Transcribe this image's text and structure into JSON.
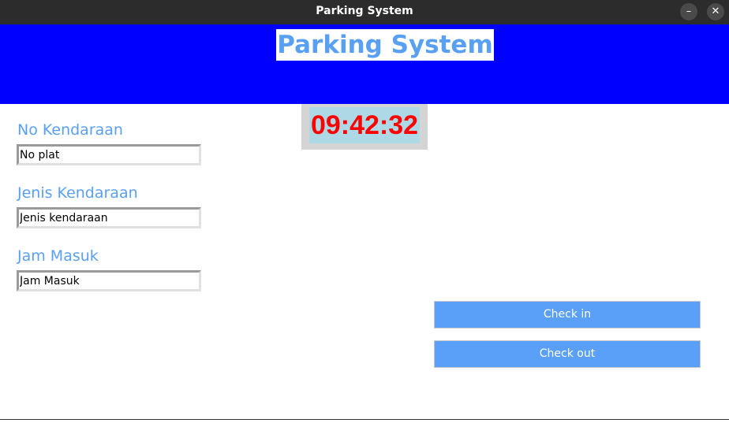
{
  "window": {
    "title": "Parking System",
    "minimize_glyph": "–",
    "close_glyph": "✕"
  },
  "header": {
    "title": "Parking System",
    "background_color": "#0000ff",
    "title_color": "#5aa0f2"
  },
  "clock": {
    "time": "09:42:32",
    "text_color": "#ff0000",
    "background_color": "#add8e6"
  },
  "form": {
    "plate": {
      "label": "No Kendaraan",
      "value": "No plat"
    },
    "vehicle_type": {
      "label": "Jenis Kendaraan",
      "value": "Jenis kendaraan"
    },
    "entry_time": {
      "label": "Jam Masuk",
      "value": "Jam Masuk"
    }
  },
  "actions": {
    "check_in_label": "Check in",
    "check_out_label": "Check out",
    "button_color": "#5aa0f8"
  }
}
